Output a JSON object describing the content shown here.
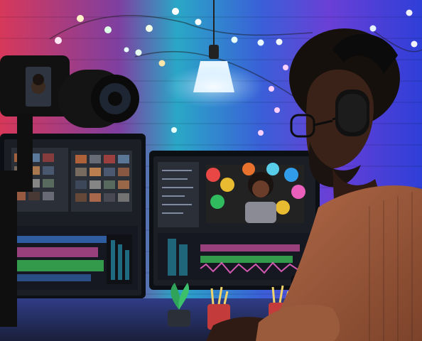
{
  "scene": {
    "description_colors": {
      "wall_left": "#d7385a",
      "wall_mid": "#2aa7c6",
      "wall_right": "#2e3fd8",
      "lights": "#f7f3c8",
      "screen_bg": "#1b1e24",
      "sweater": "#9a5a3c",
      "skin": "#3a2218"
    }
  },
  "elements": {
    "camera": "camera",
    "left_monitor": "video-editor-monitor",
    "center_monitor": "video-editor-monitor",
    "laptop": "laptop",
    "person": "editor-person",
    "headphones": "headphones",
    "lamp": "pendant-lamp",
    "plant": "potted-plant",
    "pencil_cups": "pencil-cups"
  }
}
